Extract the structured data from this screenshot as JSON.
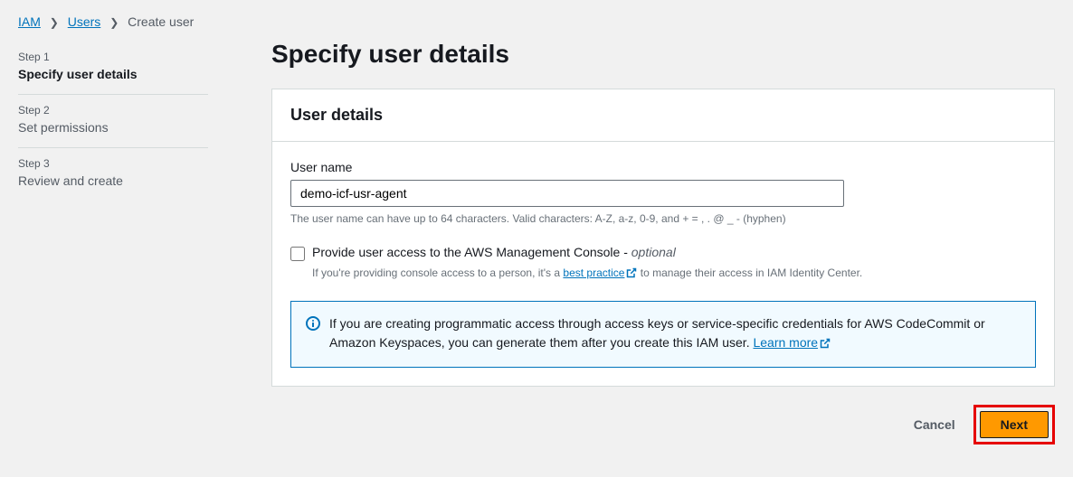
{
  "breadcrumb": {
    "iam": "IAM",
    "users": "Users",
    "current": "Create user"
  },
  "steps": [
    {
      "label": "Step 1",
      "title": "Specify user details"
    },
    {
      "label": "Step 2",
      "title": "Set permissions"
    },
    {
      "label": "Step 3",
      "title": "Review and create"
    }
  ],
  "page": {
    "title": "Specify user details"
  },
  "panel": {
    "header": "User details",
    "username_label": "User name",
    "username_value": "demo-icf-usr-agent",
    "username_hint": "The user name can have up to 64 characters. Valid characters: A-Z, a-z, 0-9, and + = , . @ _ - (hyphen)",
    "console_checkbox_text": "Provide user access to the AWS Management Console - ",
    "console_optional": "optional",
    "console_desc_before": "If you're providing console access to a person, it's a ",
    "console_desc_link": "best practice",
    "console_desc_after": " to manage their access in IAM Identity Center.",
    "info_text": "If you are creating programmatic access through access keys or service-specific credentials for AWS CodeCommit or Amazon Keyspaces, you can generate them after you create this IAM user. ",
    "info_link": "Learn more"
  },
  "actions": {
    "cancel": "Cancel",
    "next": "Next"
  }
}
